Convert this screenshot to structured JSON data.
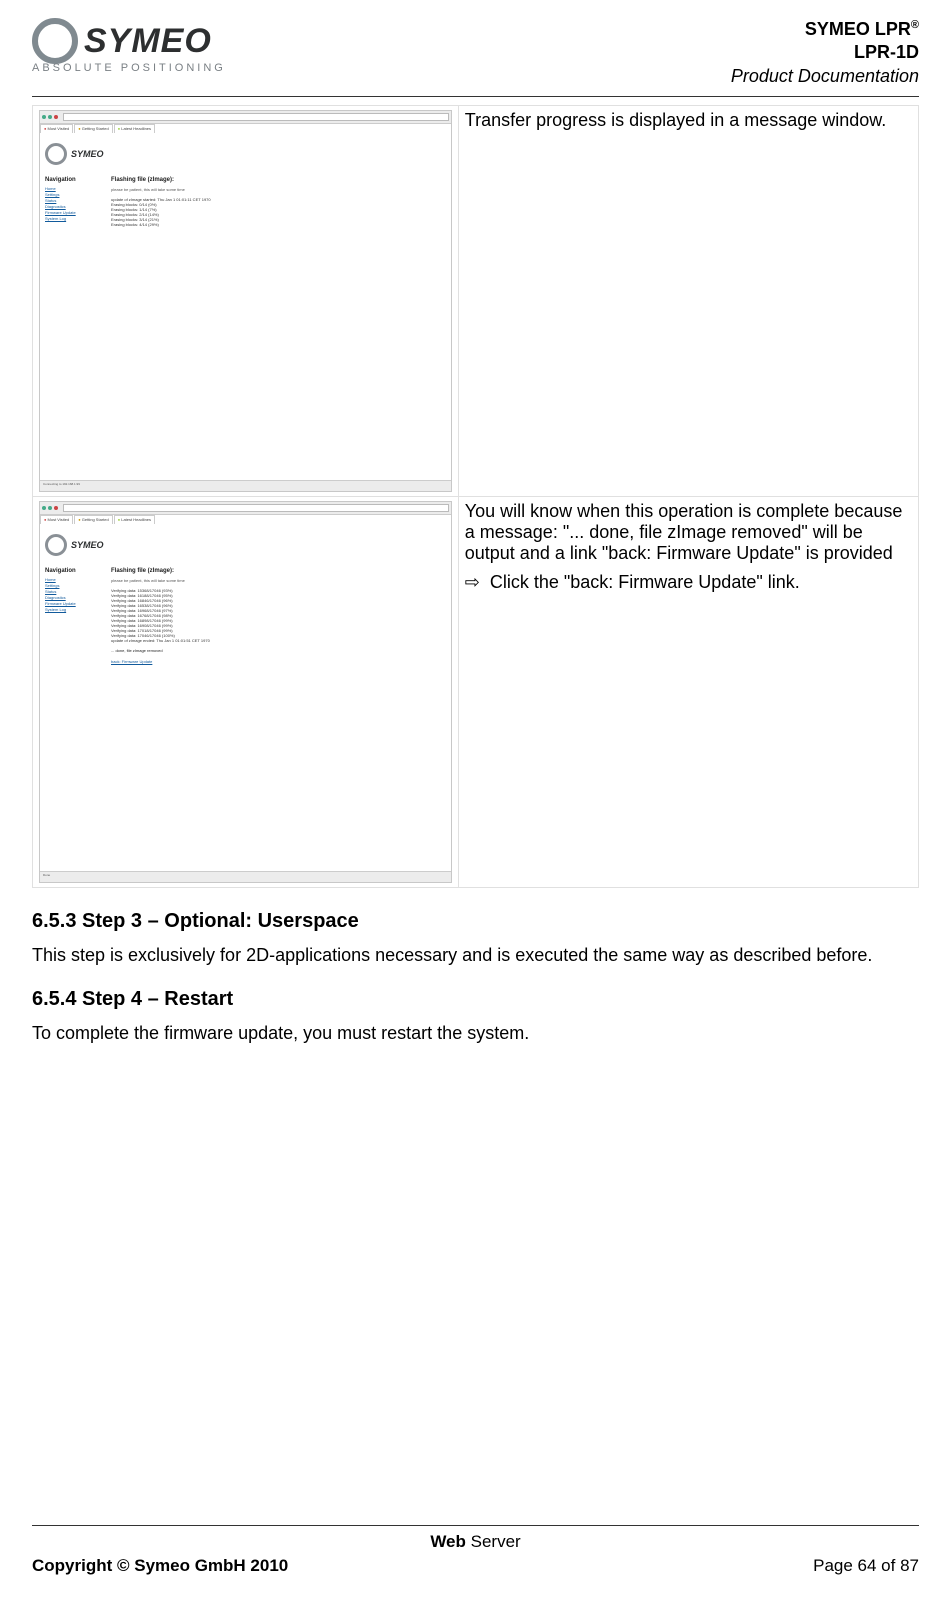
{
  "header": {
    "logo_word": "SYMEO",
    "logo_sub": "ABSOLUTE POSITIONING",
    "line1": "SYMEO LPR",
    "line1_sup": "®",
    "line2": "LPR-1D",
    "line3": "Product Documentation"
  },
  "table": {
    "row1": {
      "desc": "Transfer progress is displayed in a message window.",
      "mini": {
        "tabs": [
          "Most Visited",
          "Getting Started",
          "Latest Headlines"
        ],
        "nav_title": "Navigation",
        "nav_items": [
          "Home",
          "Settings",
          "Status",
          "Diagnostics",
          "Firmware Update",
          "System Log"
        ],
        "heading": "Flashing file (zImage):",
        "sub": "please be patient, this will take some time",
        "lines": [
          "update of zImage started: Thu Jan 1 01:01:11 CET 1970",
          "Erasing blocks: 0/14 (0%)",
          "Erasing blocks: 1/14 (7%)",
          "Erasing blocks: 2/14 (14%)",
          "Erasing blocks: 3/14 (21%)",
          "Erasing blocks: 4/14 (29%)"
        ],
        "footer_status": "Connecting to 192.168.1.99"
      }
    },
    "row2": {
      "desc_p1": "You will know when this operation is complete because a message: \"...  done, file zImage removed\" will be output and a link \"back: Firmware Update\" is provided",
      "action_arrow": "⇨",
      "action_text": "Click the \"back: Firmware Update\" link.",
      "mini": {
        "tabs": [
          "Most Visited",
          "Getting Started",
          "Latest Headlines"
        ],
        "nav_title": "Navigation",
        "nav_items": [
          "Home",
          "Settings",
          "Status",
          "Diagnostics",
          "Firmware Update",
          "System Log"
        ],
        "heading": "Flashing file (zImage):",
        "sub": "please be patient, this will take some time",
        "lines": [
          "Verifying data: 15368/17046 (93%)",
          "Verifying data: 16188/17046 (95%)",
          "Verifying data: 16846/17046 (96%)",
          "Verifying data: 16538/17046 (96%)",
          "Verifying data: 16968/17046 (97%)",
          "Verifying data: 16768/17046 (98%)",
          "Verifying data: 16898/17046 (99%)",
          "Verifying data: 16908/17046 (99%)",
          "Verifying data: 17018/17046 (99%)",
          "Verifying data: 17046/17046 (100%)",
          "update of zImage ended: Thu Jan 1 01:01:51 CET 1970"
        ],
        "done_msg": "... done, file zImage removed",
        "back_link": "back: Firmware Update",
        "footer_status": "Done"
      }
    }
  },
  "sections": {
    "s653_title": "6.5.3    Step 3 – Optional: Userspace",
    "s653_body": "This step is exclusively for 2D-applications necessary and is executed the same way as described before.",
    "s654_title": "6.5.4    Step 4 – Restart",
    "s654_body": "To complete the firmware update, you must restart the system."
  },
  "footer": {
    "center_bold": "Web",
    "center_rest": " Server",
    "copyright": "Copyright © Symeo GmbH 2010",
    "page": "Page 64 of 87"
  }
}
